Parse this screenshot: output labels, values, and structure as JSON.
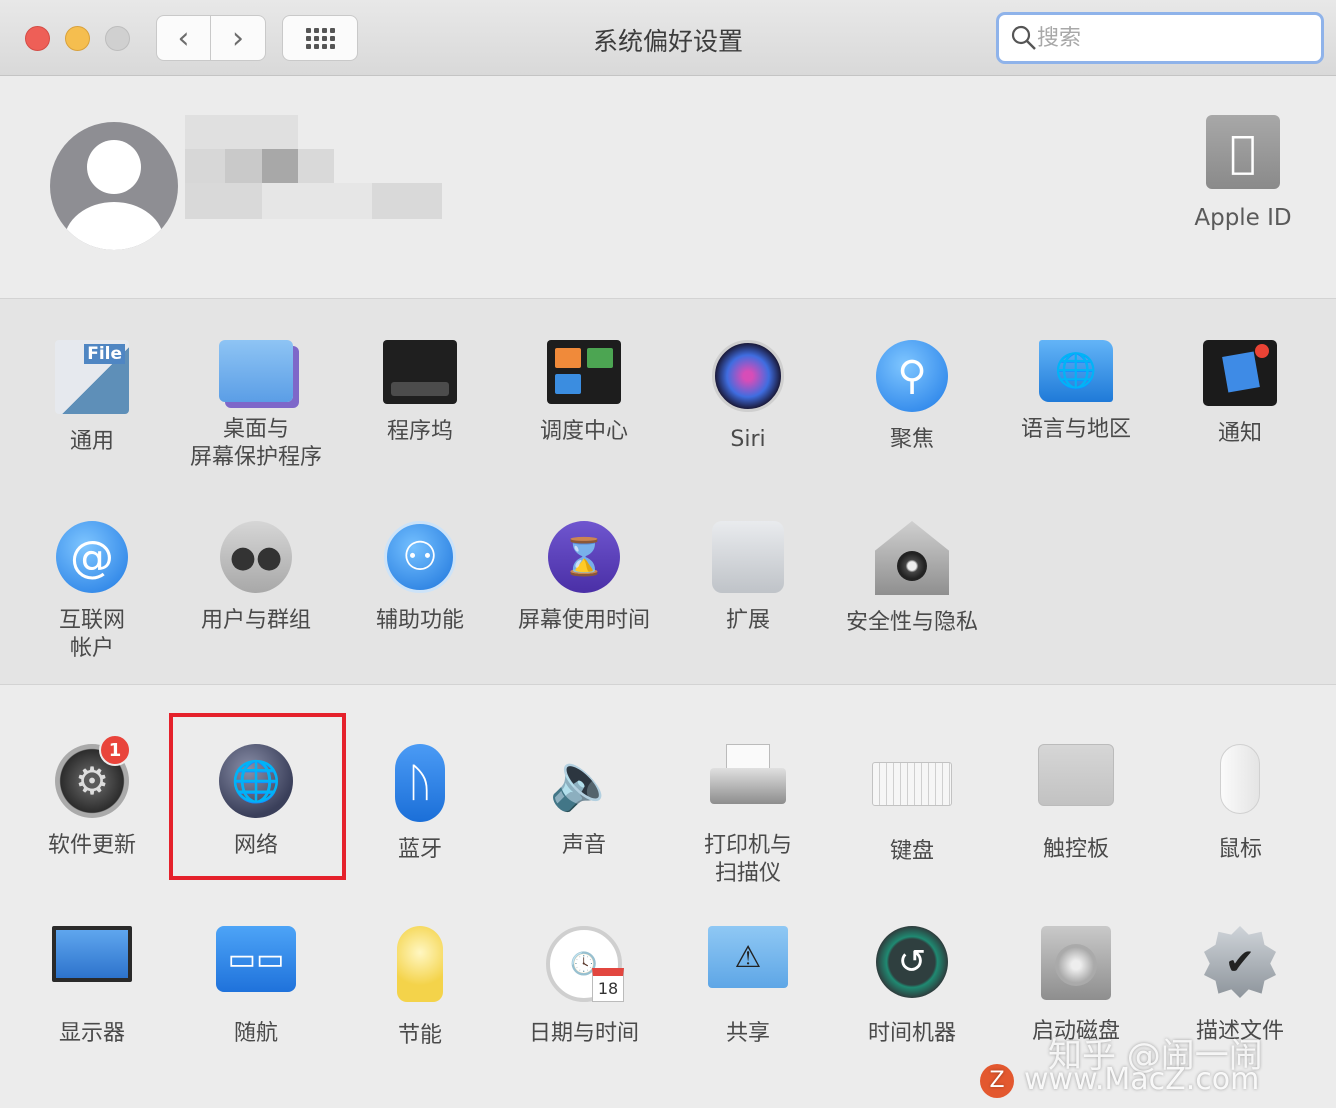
{
  "window": {
    "title": "系统偏好设置",
    "search_placeholder": "搜索"
  },
  "account": {
    "apple_id_label": "Apple ID"
  },
  "section1": {
    "items": [
      {
        "label": "通用",
        "icon": "general-icon"
      },
      {
        "label": "桌面与\n屏幕保护程序",
        "icon": "desktop-screensaver-icon"
      },
      {
        "label": "程序坞",
        "icon": "dock-icon"
      },
      {
        "label": "调度中心",
        "icon": "mission-control-icon"
      },
      {
        "label": "Siri",
        "icon": "siri-icon"
      },
      {
        "label": "聚焦",
        "icon": "spotlight-icon"
      },
      {
        "label": "语言与地区",
        "icon": "language-region-icon"
      },
      {
        "label": "通知",
        "icon": "notifications-icon"
      },
      {
        "label": "互联网\n帐户",
        "icon": "internet-accounts-icon"
      },
      {
        "label": "用户与群组",
        "icon": "users-groups-icon"
      },
      {
        "label": "辅助功能",
        "icon": "accessibility-icon"
      },
      {
        "label": "屏幕使用时间",
        "icon": "screen-time-icon"
      },
      {
        "label": "扩展",
        "icon": "extensions-icon"
      },
      {
        "label": "安全性与隐私",
        "icon": "security-privacy-icon"
      }
    ],
    "general_icon_text": "File"
  },
  "section2": {
    "items": [
      {
        "label": "软件更新",
        "icon": "software-update-icon",
        "badge": "1"
      },
      {
        "label": "网络",
        "icon": "network-icon"
      },
      {
        "label": "蓝牙",
        "icon": "bluetooth-icon"
      },
      {
        "label": "声音",
        "icon": "sound-icon"
      },
      {
        "label": "打印机与\n扫描仪",
        "icon": "printer-scanner-icon"
      },
      {
        "label": "键盘",
        "icon": "keyboard-icon"
      },
      {
        "label": "触控板",
        "icon": "trackpad-icon"
      },
      {
        "label": "鼠标",
        "icon": "mouse-icon"
      },
      {
        "label": "显示器",
        "icon": "displays-icon"
      },
      {
        "label": "随航",
        "icon": "sidecar-icon"
      },
      {
        "label": "节能",
        "icon": "energy-saver-icon"
      },
      {
        "label": "日期与时间",
        "icon": "date-time-icon"
      },
      {
        "label": "共享",
        "icon": "sharing-icon"
      },
      {
        "label": "时间机器",
        "icon": "time-machine-icon"
      },
      {
        "label": "启动磁盘",
        "icon": "startup-disk-icon"
      },
      {
        "label": "描述文件",
        "icon": "profiles-icon"
      }
    ],
    "calendar_day": "18"
  },
  "watermark": {
    "line1": "知乎 @闹一闹",
    "line2": "www.MacZ.com",
    "logo_letter": "Z"
  },
  "colors": {
    "highlight": "#e5212b",
    "badge": "#e9443b"
  }
}
